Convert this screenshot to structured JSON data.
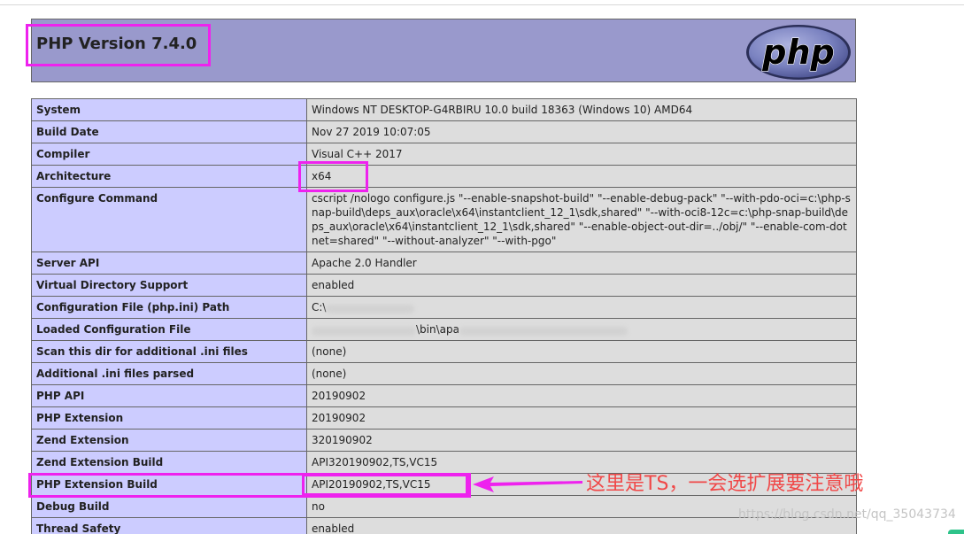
{
  "header": {
    "title": "PHP Version 7.4.0",
    "logo_text": "php"
  },
  "rows": [
    {
      "key": "System",
      "value": "Windows NT DESKTOP-G4RBIRU 10.0 build 18363 (Windows 10) AMD64"
    },
    {
      "key": "Build Date",
      "value": "Nov 27 2019 10:07:05"
    },
    {
      "key": "Compiler",
      "value": "Visual C++ 2017"
    },
    {
      "key": "Architecture",
      "value": "x64"
    },
    {
      "key": "Configure Command",
      "value": "cscript /nologo configure.js \"--enable-snapshot-build\" \"--enable-debug-pack\" \"--with-pdo-oci=c:\\php-snap-build\\deps_aux\\oracle\\x64\\instantclient_12_1\\sdk,shared\" \"--with-oci8-12c=c:\\php-snap-build\\deps_aux\\oracle\\x64\\instantclient_12_1\\sdk,shared\" \"--enable-object-out-dir=../obj/\" \"--enable-com-dotnet=shared\" \"--without-analyzer\" \"--with-pgo\""
    },
    {
      "key": "Server API",
      "value": "Apache 2.0 Handler"
    },
    {
      "key": "Virtual Directory Support",
      "value": "enabled"
    },
    {
      "key": "Configuration File (php.ini) Path",
      "value": "C:\\"
    },
    {
      "key": "Loaded Configuration File",
      "value": "\\bin\\apa"
    },
    {
      "key": "Scan this dir for additional .ini files",
      "value": "(none)"
    },
    {
      "key": "Additional .ini files parsed",
      "value": "(none)"
    },
    {
      "key": "PHP API",
      "value": "20190902"
    },
    {
      "key": "PHP Extension",
      "value": "20190902"
    },
    {
      "key": "Zend Extension",
      "value": "320190902"
    },
    {
      "key": "Zend Extension Build",
      "value": "API320190902,TS,VC15"
    },
    {
      "key": "PHP Extension Build",
      "value": "API20190902,TS,VC15"
    },
    {
      "key": "Debug Build",
      "value": "no"
    },
    {
      "key": "Thread Safety",
      "value": "enabled"
    }
  ],
  "annotation": {
    "text": "这里是TS，一会选扩展要注意哦"
  },
  "watermark": "https://blog.csdn.net/qq_35043734",
  "colors": {
    "header_bg": "#9999cc",
    "key_bg": "#ccccff",
    "value_bg": "#dddddd",
    "highlight": "#ee22ee",
    "annotation": "#f04848"
  }
}
